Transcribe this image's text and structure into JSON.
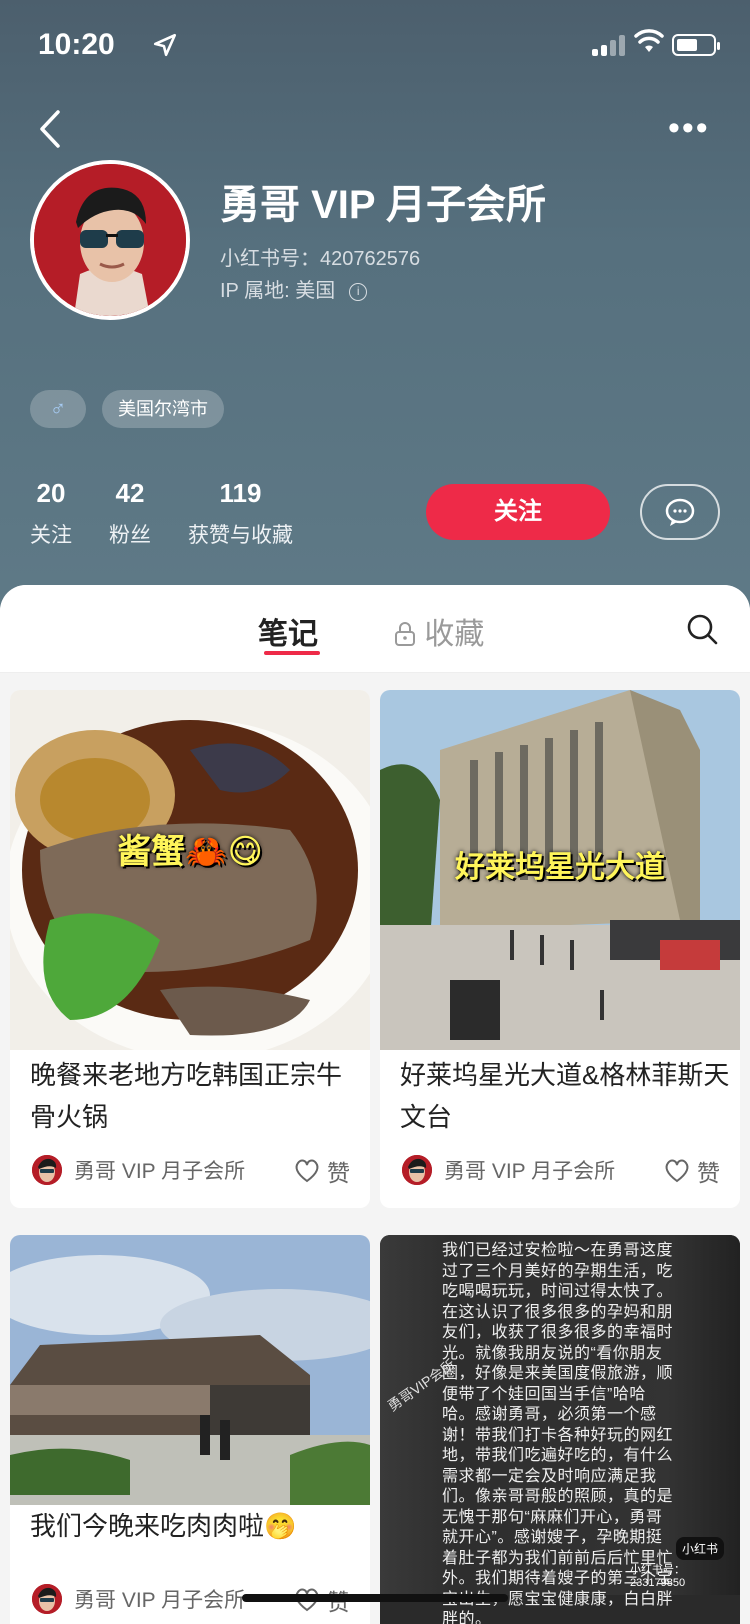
{
  "status_bar": {
    "time": "10:20",
    "location_icon": "location-arrow-icon",
    "signal_icon": "signal-icon",
    "wifi_icon": "wifi-icon",
    "battery_icon": "battery-icon"
  },
  "nav": {
    "back_icon": "chevron-left-icon",
    "more_label": "•••"
  },
  "profile": {
    "name": "勇哥 VIP 月子会所",
    "uid": "小红书号：420762576",
    "ip": "IP 属地: 美国",
    "info_glyph": "i",
    "gender_glyph": "♂",
    "location_tag": "美国尔湾市"
  },
  "stats": [
    {
      "num": "20",
      "label": "关注"
    },
    {
      "num": "42",
      "label": "粉丝"
    },
    {
      "num": "119",
      "label": "获赞与收藏"
    }
  ],
  "actions": {
    "follow": "关注"
  },
  "tabs": {
    "notes": "笔记",
    "collect": "收藏"
  },
  "notes": [
    {
      "overlay": "酱蟹🦀😋",
      "title": "晚餐来老地方吃韩国正宗牛骨火锅",
      "author": "勇哥 VIP 月子会所",
      "like": "赞"
    },
    {
      "overlay": "好莱坞星光大道",
      "title": "好莱坞星光大道&格林菲斯天文台",
      "author": "勇哥 VIP 月子会所",
      "like": "赞"
    },
    {
      "overlay": "",
      "title": "我们今晚来吃肉肉啦🤭",
      "author": "勇哥 VIP 月子会所",
      "like": "赞"
    },
    {
      "overlay": "我们已经过安检啦～在勇哥这度过了三个月美好的孕期生活，吃吃喝喝玩玩，时间过得太快了。在这认识了很多很多的孕妈和朋友们，收获了很多很多的幸福时光。就像我朋友说的“看你朋友圈，好像是来美国度假旅游，顺便带了个娃回国当手信”哈哈哈。感谢勇哥，必须第一个感谢！带我们打卡各种好玩的网红地，带我们吃遍好吃的，有什么需求都一定会及时响应满足我们。像亲哥哥般的照顾，真的是无愧于那句“麻麻们开心，勇哥就开心”。感谢嫂子，孕晚期挺着肚子都为我们前前后后忙里忙外。我们期待着嫂子的第三个宝宝出生，愿宝宝健康康，白白胖胖的。",
      "watermark": "小红书",
      "watermark_id": "小红书号：233179850",
      "side_text": "勇哥VIP会所",
      "title": "",
      "author": "",
      "like": ""
    }
  ]
}
